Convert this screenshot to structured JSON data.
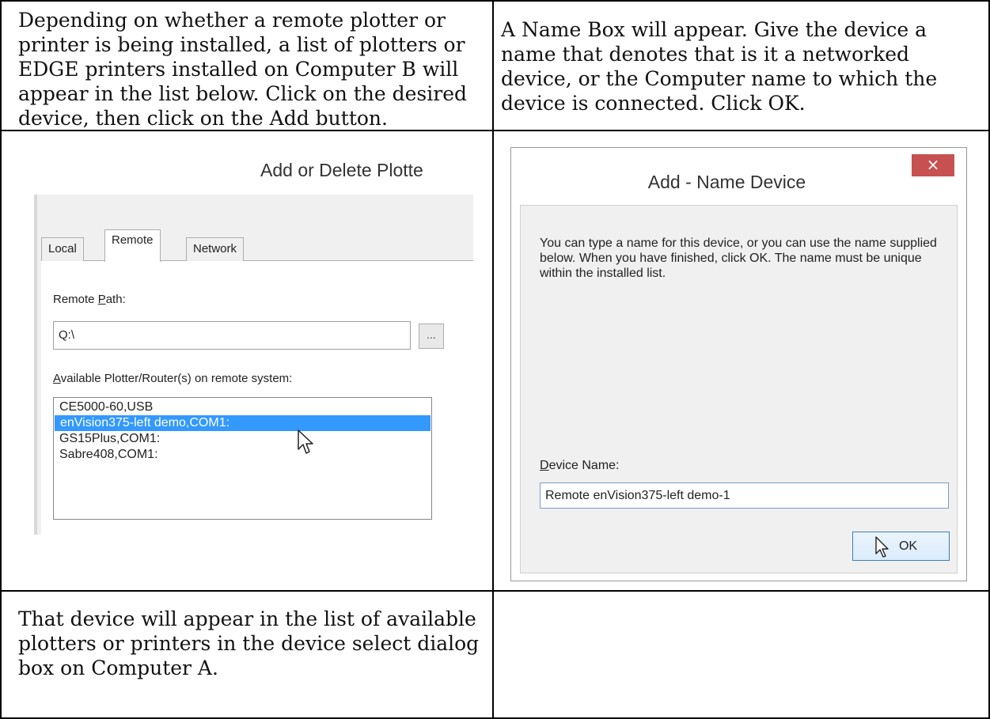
{
  "row1": {
    "left_text": "Depending on whether a remote plotter or printer is being installed, a list of plotters or EDGE printers installed on Computer B will appear in the list below. Click on the desired device, then click on the Add button.",
    "right_text": "A Name Box will appear. Give the device a name that denotes that is it a networked device, or the Computer name to which the device is connected. Click OK."
  },
  "row3": {
    "left_text": "That device will appear in the list of available plotters or printers in the device select dialog box on Computer A.",
    "right_text": ""
  },
  "plotter_dialog": {
    "title": "Add or Delete Plotte",
    "tabs": [
      "Local",
      "Remote",
      "Network"
    ],
    "active_tab": "Remote",
    "remote_path_label_pre": "Remote ",
    "remote_path_label_key": "P",
    "remote_path_label_post": "ath:",
    "remote_path_value": "Q:\\",
    "browse_label": "...",
    "available_label_key": "A",
    "available_label_post": "vailable Plotter/Router(s) on remote system:",
    "plotters": [
      "CE5000-60,USB",
      "enVision375-left demo,COM1:",
      "GS15Plus,COM1:",
      "Sabre408,COM1:"
    ],
    "selected_index": 1
  },
  "name_dialog": {
    "title": "Add - Name Device",
    "close_glyph": "×",
    "description": "You can type a name for this device, or you can use the name supplied below. When you have finished, click OK. The name must be unique within the installed list.",
    "device_name_label_key": "D",
    "device_name_label_post": "evice Name:",
    "device_name_value": "Remote enVision375-left demo-1",
    "ok_label": "OK"
  },
  "colors": {
    "selection": "#3399ff",
    "close_button": "#c75050",
    "ok_border": "#3c7fb1"
  },
  "icons": {
    "cursor": "mouse-pointer-icon"
  }
}
